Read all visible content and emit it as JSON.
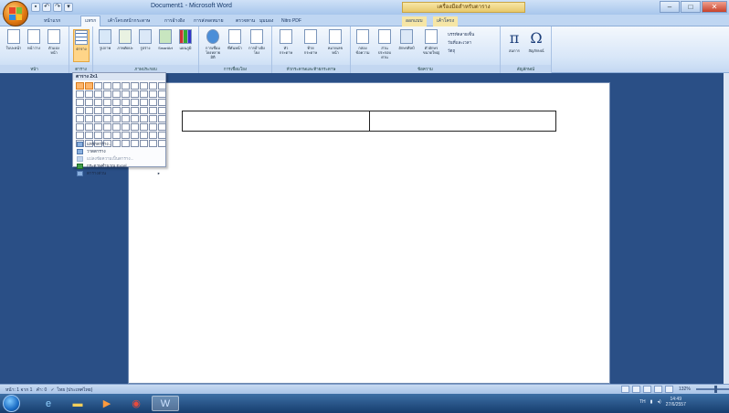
{
  "titlebar": {
    "title": "Document1 - Microsoft Word",
    "context_title": "เครื่องมือสำหรับตาราง",
    "quick_access": [
      "save-icon",
      "undo-icon",
      "redo-icon",
      "customize-icon"
    ],
    "window_buttons": {
      "minimize": "–",
      "maximize": "□",
      "close": "✕"
    }
  },
  "tabs": [
    {
      "label": "หน้าแรก"
    },
    {
      "label": "แทรก",
      "active": true
    },
    {
      "label": "เค้าโครงหน้ากระดาษ"
    },
    {
      "label": "การอ้างอิง"
    },
    {
      "label": "การส่งจดหมาย"
    },
    {
      "label": "ตรวจทาน"
    },
    {
      "label": "มุมมอง"
    },
    {
      "label": "Nitro PDF"
    },
    {
      "label": "ออกแบบ",
      "context": true
    },
    {
      "label": "เค้าโครง",
      "context": true
    }
  ],
  "ribbon": {
    "groups": [
      {
        "label": "หน้า",
        "buttons": [
          "ใบปะหน้า",
          "หน้าว่าง",
          "ตัวแบ่งหน้า"
        ]
      },
      {
        "label": "ตาราง",
        "buttons": [
          "ตาราง"
        ]
      },
      {
        "label": "ภาพประกอบ",
        "buttons": [
          "รูปภาพ",
          "ภาพตัดปะ",
          "รูปร่าง",
          "SmartArt",
          "แผนภูมิ"
        ]
      },
      {
        "label": "การเชื่อมโยง",
        "buttons": [
          "การเชื่อมโยงหลายมิติ",
          "ที่คั่นหน้า",
          "การอ้างอิงโยง"
        ]
      },
      {
        "label": "หัวกระดาษและท้ายกระดาษ",
        "buttons": [
          "หัวกระดาษ",
          "ท้ายกระดาษ",
          "หมายเลขหน้า"
        ]
      },
      {
        "label": "ข้อความ",
        "buttons": [
          "กล่องข้อความ",
          "ส่วนประกอบด่วน",
          "อักษรศิลป์",
          "ตัวอักษรขนาดใหญ่",
          "บรรทัดลายเซ็น",
          "วันที่และเวลา",
          "วัตถุ"
        ]
      },
      {
        "label": "สัญลักษณ์",
        "buttons": [
          "สมการ",
          "สัญลักษณ์"
        ]
      }
    ]
  },
  "table_dropdown": {
    "title": "ตาราง 2x1",
    "grid": {
      "columns": 10,
      "rows": 8,
      "selected_cols": 2,
      "selected_rows": 1
    },
    "menu": [
      {
        "label": "แทรกตาราง...",
        "icon": "table-insert-icon",
        "enabled": true
      },
      {
        "label": "วาดตาราง",
        "icon": "pencil-icon",
        "enabled": true
      },
      {
        "label": "แปลงข้อความเป็นตาราง...",
        "icon": "convert-icon",
        "enabled": false
      },
      {
        "label": "กระดาษคำนวณ Excel",
        "icon": "excel-icon",
        "enabled": true
      },
      {
        "label": "ตารางด่วน",
        "icon": "quick-table-icon",
        "enabled": true,
        "submenu": true
      }
    ]
  },
  "document": {
    "table": {
      "rows": 1,
      "cols": 2
    }
  },
  "statusbar": {
    "page": "หน้า: 1 จาก 1",
    "words": "คำ: 0",
    "language": "ไทย (ประเทศไทย)",
    "zoom": "132%"
  },
  "taskbar": {
    "apps": [
      "ie-icon",
      "folder-icon",
      "media-player-icon",
      "chrome-icon",
      "word-icon"
    ],
    "lang": "TH",
    "time": "14:49",
    "date": "27/6/2557"
  }
}
